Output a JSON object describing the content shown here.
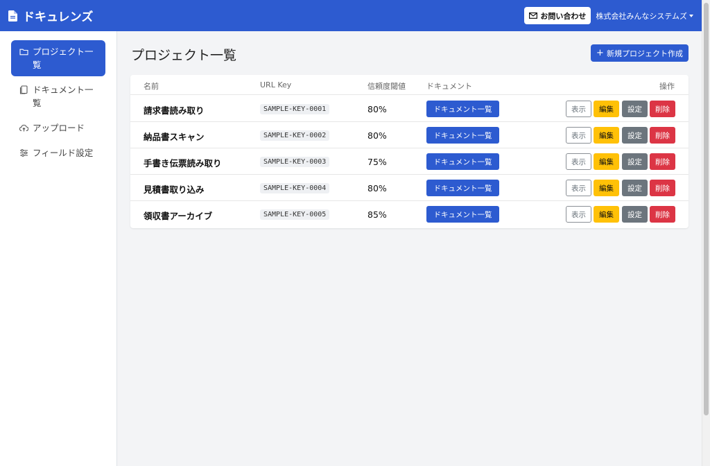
{
  "app": {
    "title": "ドキュレンズ",
    "contact_label": "お問い合わせ",
    "company": "株式会社みんなシステムズ"
  },
  "sidebar": {
    "items": [
      {
        "label": "プロジェクト一覧",
        "icon": "folder-icon",
        "active": true
      },
      {
        "label": "ドキュメント一覧",
        "icon": "documents-icon",
        "active": false
      },
      {
        "label": "アップロード",
        "icon": "cloud-upload-icon",
        "active": false
      },
      {
        "label": "フィールド設定",
        "icon": "sliders-icon",
        "active": false
      }
    ]
  },
  "main": {
    "title": "プロジェクト一覧",
    "new_project_label": "新規プロジェクト作成",
    "table": {
      "headers": {
        "name": "名前",
        "url_key": "URL Key",
        "threshold": "信頼度閾値",
        "documents": "ドキュメント",
        "actions": "操作"
      },
      "rows": [
        {
          "name": "請求書読み取り",
          "url_key": "SAMPLE-KEY-0001",
          "threshold": "80%",
          "doc_button": "ドキュメント一覧",
          "view": "表示",
          "edit": "編集",
          "settings": "設定",
          "delete": "削除"
        },
        {
          "name": "納品書スキャン",
          "url_key": "SAMPLE-KEY-0002",
          "threshold": "80%",
          "doc_button": "ドキュメント一覧",
          "view": "表示",
          "edit": "編集",
          "settings": "設定",
          "delete": "削除"
        },
        {
          "name": "手書き伝票読み取り",
          "url_key": "SAMPLE-KEY-0003",
          "threshold": "75%",
          "doc_button": "ドキュメント一覧",
          "view": "表示",
          "edit": "編集",
          "settings": "設定",
          "delete": "削除"
        },
        {
          "name": "見積書取り込み",
          "url_key": "SAMPLE-KEY-0004",
          "threshold": "80%",
          "doc_button": "ドキュメント一覧",
          "view": "表示",
          "edit": "編集",
          "settings": "設定",
          "delete": "削除"
        },
        {
          "name": "領収書アーカイブ",
          "url_key": "SAMPLE-KEY-0005",
          "threshold": "85%",
          "doc_button": "ドキュメント一覧",
          "view": "表示",
          "edit": "編集",
          "settings": "設定",
          "delete": "削除"
        }
      ]
    }
  },
  "colors": {
    "primary": "#2d5bd0",
    "warning": "#ffc107",
    "secondary": "#6c757d",
    "danger": "#dc3545",
    "background": "#f3f4f6"
  }
}
